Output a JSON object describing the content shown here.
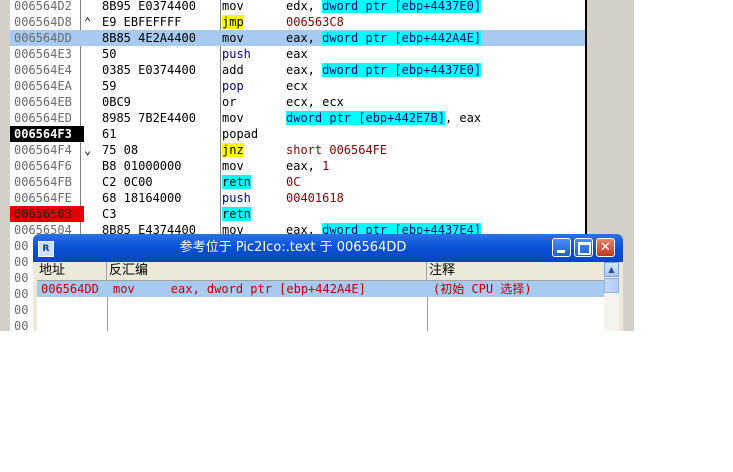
{
  "disassembly": {
    "rows": [
      {
        "addr": "006564D2",
        "arrow": "",
        "hex": "8B95 E0374400",
        "mn": "mov",
        "mnclass": "m-norm",
        "op": [
          {
            "t": "edx, ",
            "c": "reg"
          },
          {
            "t": "dword ptr [ebp+4437E0]",
            "c": "mem"
          }
        ]
      },
      {
        "addr": "006564D8",
        "arrow": "^",
        "hex": "E9 EBFEFFFF",
        "mn": "jmp",
        "mnclass": "m-jmp",
        "op": [
          {
            "t": "006563C8",
            "c": "tgt"
          }
        ]
      },
      {
        "addr": "006564DD",
        "arrow": "",
        "hex": "8B85 4E2A4400",
        "mn": "mov",
        "mnclass": "m-norm",
        "op": [
          {
            "t": "eax, ",
            "c": "reg"
          },
          {
            "t": "dword ptr [ebp+442A4E]",
            "c": "mem"
          }
        ],
        "selected": true
      },
      {
        "addr": "006564E3",
        "arrow": "",
        "hex": "50",
        "mn": "push",
        "mnclass": "m-push",
        "op": [
          {
            "t": "eax",
            "c": "reg"
          }
        ]
      },
      {
        "addr": "006564E4",
        "arrow": "",
        "hex": "0385 E0374400",
        "mn": "add",
        "mnclass": "m-norm",
        "op": [
          {
            "t": "eax, ",
            "c": "reg"
          },
          {
            "t": "dword ptr [ebp+4437E0]",
            "c": "mem"
          }
        ]
      },
      {
        "addr": "006564EA",
        "arrow": "",
        "hex": "59",
        "mn": "pop",
        "mnclass": "m-pop",
        "op": [
          {
            "t": "ecx",
            "c": "reg"
          }
        ]
      },
      {
        "addr": "006564EB",
        "arrow": "",
        "hex": "0BC9",
        "mn": "or",
        "mnclass": "m-norm",
        "op": [
          {
            "t": "ecx, ecx",
            "c": "reg"
          }
        ]
      },
      {
        "addr": "006564ED",
        "arrow": "",
        "hex": "8985 7B2E4400",
        "mn": "mov",
        "mnclass": "m-norm",
        "op": [
          {
            "t": "dword ptr [ebp+442E7B]",
            "c": "mem"
          },
          {
            "t": ", eax",
            "c": "reg"
          }
        ]
      },
      {
        "addr": "006564F3",
        "arrow": "",
        "hex": "61",
        "mn": "popad",
        "mnclass": "m-norm",
        "op": [],
        "current": true
      },
      {
        "addr": "006564F4",
        "arrow": "v",
        "hex": "75 08",
        "mn": "jnz",
        "mnclass": "m-jmp",
        "op": [
          {
            "t": "short 006564FE",
            "c": "tgt"
          }
        ]
      },
      {
        "addr": "006564F6",
        "arrow": "",
        "hex": "B8 01000000",
        "mn": "mov",
        "mnclass": "m-norm",
        "op": [
          {
            "t": "eax, ",
            "c": "reg"
          },
          {
            "t": "1",
            "c": "num"
          }
        ]
      },
      {
        "addr": "006564FB",
        "arrow": "",
        "hex": "C2 0C00",
        "mn": "retn",
        "mnclass": "m-ret",
        "op": [
          {
            "t": "0C",
            "c": "num"
          }
        ]
      },
      {
        "addr": "006564FE",
        "arrow": "",
        "hex": "68 18164000",
        "mn": "push",
        "mnclass": "m-push",
        "op": [
          {
            "t": "00401618",
            "c": "tgt"
          }
        ]
      },
      {
        "addr": "00656503",
        "arrow": "",
        "hex": "C3",
        "mn": "retn",
        "mnclass": "m-ret",
        "op": [],
        "breakpoint": true
      },
      {
        "addr": "00656504",
        "arrow": "",
        "hex": "8B85 E4374400",
        "mn": "mov",
        "mnclass": "m-norm",
        "op": [
          {
            "t": "eax, ",
            "c": "reg"
          },
          {
            "t": "dword ptr [ebp+4437E4]",
            "c": "mem"
          }
        ]
      },
      {
        "addr": "00",
        "arrow": "",
        "hex": "",
        "mn": "",
        "mnclass": "m-norm",
        "op": []
      },
      {
        "addr": "00",
        "arrow": "",
        "hex": "",
        "mn": "",
        "mnclass": "m-norm",
        "op": []
      },
      {
        "addr": "00",
        "arrow": "",
        "hex": "",
        "mn": "",
        "mnclass": "m-norm",
        "op": []
      },
      {
        "addr": "00",
        "arrow": "",
        "hex": "",
        "mn": "",
        "mnclass": "m-norm",
        "op": []
      },
      {
        "addr": "00",
        "arrow": "",
        "hex": "",
        "mn": "",
        "mnclass": "m-norm",
        "op": []
      },
      {
        "addr": "00",
        "arrow": "",
        "hex": "",
        "mn": "",
        "mnclass": "m-norm",
        "op": []
      }
    ]
  },
  "references_window": {
    "title": "参考位于 Pic2Ico:.text 于 006564DD",
    "icon_letter": "R",
    "headers": {
      "address": "地址",
      "disassembly": "反汇编",
      "comment": "注释"
    },
    "rows": [
      {
        "address": "006564DD",
        "disassembly": "mov     eax, dword ptr [ebp+442A4E]",
        "comment": "(初始 CPU 选择)"
      }
    ],
    "buttons": {
      "close_glyph": "✕"
    }
  },
  "colors": {
    "selection": "#a6caf0",
    "memory_highlight": "#00ffff",
    "jump_highlight": "#ffff00",
    "breakpoint": "#e00000",
    "titlebar": "#0a52d6"
  }
}
